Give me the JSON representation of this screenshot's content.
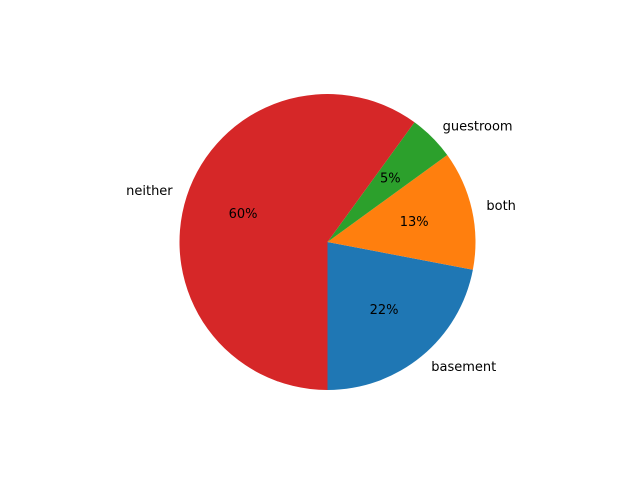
{
  "chart_data": {
    "type": "pie",
    "title": "",
    "start_angle_deg": -90,
    "direction": "counterclockwise",
    "legend": "none",
    "slices": [
      {
        "label": "basement",
        "value": 22,
        "pct_label": "22%",
        "color": "#1f77b4"
      },
      {
        "label": "both",
        "value": 13,
        "pct_label": "13%",
        "color": "#ff7f0e"
      },
      {
        "label": "guestroom",
        "value": 5,
        "pct_label": "5%",
        "color": "#2ca02c"
      },
      {
        "label": "neither",
        "value": 60,
        "pct_label": "60%",
        "color": "#d62728"
      }
    ]
  }
}
